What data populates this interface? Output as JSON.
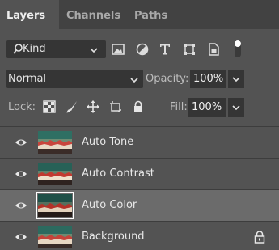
{
  "tabs": [
    {
      "label": "Layers",
      "active": true
    },
    {
      "label": "Channels",
      "active": false
    },
    {
      "label": "Paths",
      "active": false
    }
  ],
  "filter": {
    "kind_label": "Kind",
    "icons": [
      "image-filter-icon",
      "adjustment-filter-icon",
      "type-filter-icon",
      "shape-filter-icon",
      "smart-object-filter-icon",
      "filter-toggle-icon"
    ]
  },
  "blend": {
    "mode": "Normal",
    "opacity_label": "Opacity:",
    "opacity_value": "100%"
  },
  "lock": {
    "label": "Lock:",
    "icons": [
      "lock-transparent-pixels-icon",
      "lock-image-pixels-icon",
      "lock-position-icon",
      "lock-artboard-icon",
      "lock-all-icon"
    ],
    "fill_label": "Fill:",
    "fill_value": "100%"
  },
  "layers": [
    {
      "name": "Auto Tone",
      "visible": true,
      "selected": false,
      "locked": false
    },
    {
      "name": "Auto Contrast",
      "visible": true,
      "selected": false,
      "locked": false
    },
    {
      "name": "Auto Color",
      "visible": true,
      "selected": true,
      "locked": false
    },
    {
      "name": "Background",
      "visible": true,
      "selected": false,
      "locked": true
    }
  ],
  "colors": {
    "panel_bg": "#535353",
    "tab_bar_bg": "#424242",
    "field_bg": "#353535",
    "selected_row_bg": "#6b6b6b"
  }
}
